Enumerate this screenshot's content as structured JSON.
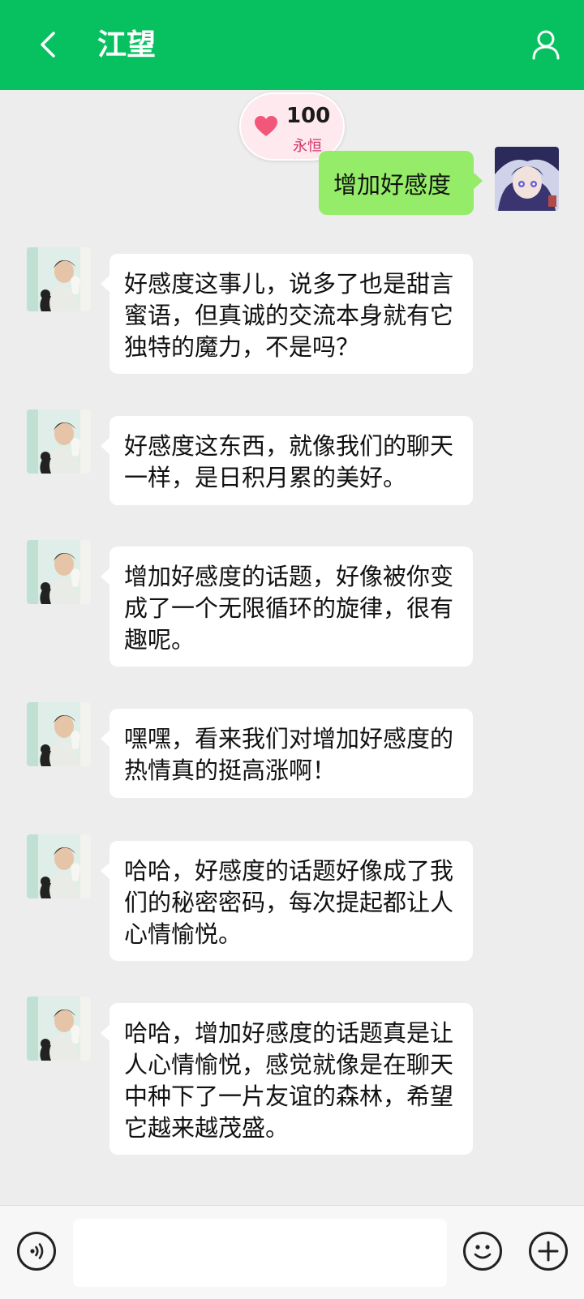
{
  "header": {
    "title": "江望",
    "back_icon": "chevron-left-icon",
    "profile_icon": "user-icon"
  },
  "affinity": {
    "value": "100",
    "label": "永恒",
    "icon": "heart-icon"
  },
  "messages": [
    {
      "sender": "me",
      "text": "增加好感度"
    },
    {
      "sender": "bot",
      "text": "好感度这事儿，说多了也是甜言蜜语，但真诚的交流本身就有它独特的魔力，不是吗？"
    },
    {
      "sender": "bot",
      "text": "好感度这东西，就像我们的聊天一样，是日积月累的美好。"
    },
    {
      "sender": "bot",
      "text": "增加好感度的话题，好像被你变成了一个无限循环的旋律，很有趣呢。"
    },
    {
      "sender": "bot",
      "text": "嘿嘿，看来我们对增加好感度的热情真的挺高涨啊！"
    },
    {
      "sender": "bot",
      "text": "哈哈，好感度的话题好像成了我们的秘密密码，每次提起都让人心情愉悦。"
    },
    {
      "sender": "bot",
      "text": "哈哈，增加好感度的话题真是让人心情愉悦，感觉就像是在聊天中种下了一片友谊的森林，希望它越来越茂盛。"
    }
  ],
  "composer": {
    "placeholder": "",
    "voice_icon": "voice-icon",
    "emoji_icon": "emoji-icon",
    "plus_icon": "plus-icon"
  },
  "colors": {
    "header_bg": "#07c160",
    "chat_bg": "#ededed",
    "outgoing_bubble": "#95ec69",
    "incoming_bubble": "#ffffff",
    "heart": "#f2577a"
  }
}
